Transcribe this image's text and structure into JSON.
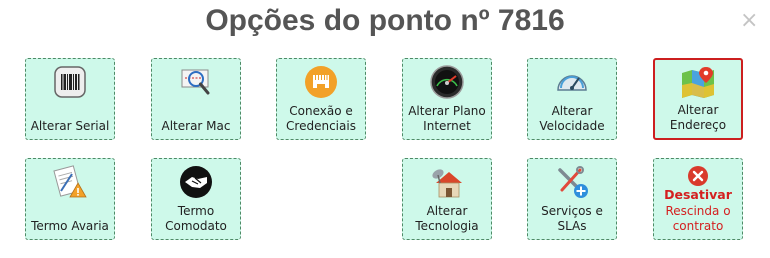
{
  "dialog": {
    "title": "Opções do ponto nº 7816",
    "close_symbol": "×"
  },
  "tiles": {
    "alterar_serial": {
      "lines": [
        "Alterar Serial"
      ],
      "icon": "barcode-icon"
    },
    "alterar_mac": {
      "lines": [
        "Alterar Mac"
      ],
      "icon": "network-magnifier-icon"
    },
    "conexao": {
      "lines": [
        "Conexão e",
        "Credenciais"
      ],
      "icon": "ethernet-port-icon"
    },
    "plano_internet": {
      "lines": [
        "Alterar Plano",
        "Internet"
      ],
      "icon": "speed-gauge-icon"
    },
    "velocidade": {
      "lines": [
        "Alterar",
        "Velocidade"
      ],
      "icon": "speedometer-icon"
    },
    "endereco": {
      "lines": [
        "Alterar",
        "Endereço"
      ],
      "icon": "map-pin-icon",
      "selected": true
    },
    "termo_avaria": {
      "lines": [
        "Termo Avaria"
      ],
      "icon": "document-warning-icon"
    },
    "termo_comodato": {
      "lines": [
        "Termo",
        "Comodato"
      ],
      "icon": "handshake-icon"
    },
    "tecnologia": {
      "lines": [
        "Alterar",
        "Tecnologia"
      ],
      "icon": "house-antenna-icon"
    },
    "servicos": {
      "lines": [
        "Serviços e",
        "SLAs"
      ],
      "icon": "tools-add-icon"
    },
    "desativar": {
      "lines": [
        "Desativar",
        "Rescinda o",
        "contrato"
      ],
      "icon": "close-circle-icon"
    }
  },
  "colors": {
    "tile_bg": "#cef9ea",
    "tile_border": "#4e8a66",
    "selected_border": "#cc1f1f",
    "danger_text": "#d41f1f",
    "title_text": "#555555"
  }
}
